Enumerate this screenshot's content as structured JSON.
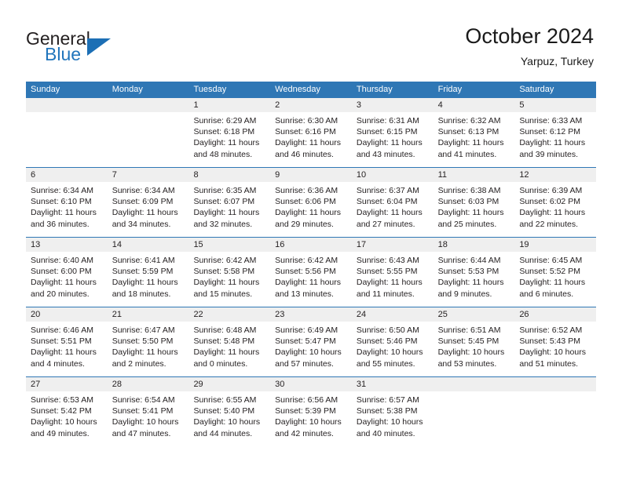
{
  "brand": {
    "word1": "General",
    "word2": "Blue",
    "triangle_color": "#1c6fb5",
    "blue_text_color": "#2175bc"
  },
  "header": {
    "title": "October 2024",
    "subtitle": "Yarpuz, Turkey"
  },
  "theme": {
    "header_blue": "#2f77b5",
    "datebar_gray": "#efefef",
    "cell_white": "#ffffff",
    "text": "#231f20"
  },
  "weekdays": [
    "Sunday",
    "Monday",
    "Tuesday",
    "Wednesday",
    "Thursday",
    "Friday",
    "Saturday"
  ],
  "weeks": [
    [
      {
        "day": "",
        "lines": []
      },
      {
        "day": "",
        "lines": []
      },
      {
        "day": "1",
        "lines": [
          "Sunrise: 6:29 AM",
          "Sunset: 6:18 PM",
          "Daylight: 11 hours",
          "and 48 minutes."
        ]
      },
      {
        "day": "2",
        "lines": [
          "Sunrise: 6:30 AM",
          "Sunset: 6:16 PM",
          "Daylight: 11 hours",
          "and 46 minutes."
        ]
      },
      {
        "day": "3",
        "lines": [
          "Sunrise: 6:31 AM",
          "Sunset: 6:15 PM",
          "Daylight: 11 hours",
          "and 43 minutes."
        ]
      },
      {
        "day": "4",
        "lines": [
          "Sunrise: 6:32 AM",
          "Sunset: 6:13 PM",
          "Daylight: 11 hours",
          "and 41 minutes."
        ]
      },
      {
        "day": "5",
        "lines": [
          "Sunrise: 6:33 AM",
          "Sunset: 6:12 PM",
          "Daylight: 11 hours",
          "and 39 minutes."
        ]
      }
    ],
    [
      {
        "day": "6",
        "lines": [
          "Sunrise: 6:34 AM",
          "Sunset: 6:10 PM",
          "Daylight: 11 hours",
          "and 36 minutes."
        ]
      },
      {
        "day": "7",
        "lines": [
          "Sunrise: 6:34 AM",
          "Sunset: 6:09 PM",
          "Daylight: 11 hours",
          "and 34 minutes."
        ]
      },
      {
        "day": "8",
        "lines": [
          "Sunrise: 6:35 AM",
          "Sunset: 6:07 PM",
          "Daylight: 11 hours",
          "and 32 minutes."
        ]
      },
      {
        "day": "9",
        "lines": [
          "Sunrise: 6:36 AM",
          "Sunset: 6:06 PM",
          "Daylight: 11 hours",
          "and 29 minutes."
        ]
      },
      {
        "day": "10",
        "lines": [
          "Sunrise: 6:37 AM",
          "Sunset: 6:04 PM",
          "Daylight: 11 hours",
          "and 27 minutes."
        ]
      },
      {
        "day": "11",
        "lines": [
          "Sunrise: 6:38 AM",
          "Sunset: 6:03 PM",
          "Daylight: 11 hours",
          "and 25 minutes."
        ]
      },
      {
        "day": "12",
        "lines": [
          "Sunrise: 6:39 AM",
          "Sunset: 6:02 PM",
          "Daylight: 11 hours",
          "and 22 minutes."
        ]
      }
    ],
    [
      {
        "day": "13",
        "lines": [
          "Sunrise: 6:40 AM",
          "Sunset: 6:00 PM",
          "Daylight: 11 hours",
          "and 20 minutes."
        ]
      },
      {
        "day": "14",
        "lines": [
          "Sunrise: 6:41 AM",
          "Sunset: 5:59 PM",
          "Daylight: 11 hours",
          "and 18 minutes."
        ]
      },
      {
        "day": "15",
        "lines": [
          "Sunrise: 6:42 AM",
          "Sunset: 5:58 PM",
          "Daylight: 11 hours",
          "and 15 minutes."
        ]
      },
      {
        "day": "16",
        "lines": [
          "Sunrise: 6:42 AM",
          "Sunset: 5:56 PM",
          "Daylight: 11 hours",
          "and 13 minutes."
        ]
      },
      {
        "day": "17",
        "lines": [
          "Sunrise: 6:43 AM",
          "Sunset: 5:55 PM",
          "Daylight: 11 hours",
          "and 11 minutes."
        ]
      },
      {
        "day": "18",
        "lines": [
          "Sunrise: 6:44 AM",
          "Sunset: 5:53 PM",
          "Daylight: 11 hours",
          "and 9 minutes."
        ]
      },
      {
        "day": "19",
        "lines": [
          "Sunrise: 6:45 AM",
          "Sunset: 5:52 PM",
          "Daylight: 11 hours",
          "and 6 minutes."
        ]
      }
    ],
    [
      {
        "day": "20",
        "lines": [
          "Sunrise: 6:46 AM",
          "Sunset: 5:51 PM",
          "Daylight: 11 hours",
          "and 4 minutes."
        ]
      },
      {
        "day": "21",
        "lines": [
          "Sunrise: 6:47 AM",
          "Sunset: 5:50 PM",
          "Daylight: 11 hours",
          "and 2 minutes."
        ]
      },
      {
        "day": "22",
        "lines": [
          "Sunrise: 6:48 AM",
          "Sunset: 5:48 PM",
          "Daylight: 11 hours",
          "and 0 minutes."
        ]
      },
      {
        "day": "23",
        "lines": [
          "Sunrise: 6:49 AM",
          "Sunset: 5:47 PM",
          "Daylight: 10 hours",
          "and 57 minutes."
        ]
      },
      {
        "day": "24",
        "lines": [
          "Sunrise: 6:50 AM",
          "Sunset: 5:46 PM",
          "Daylight: 10 hours",
          "and 55 minutes."
        ]
      },
      {
        "day": "25",
        "lines": [
          "Sunrise: 6:51 AM",
          "Sunset: 5:45 PM",
          "Daylight: 10 hours",
          "and 53 minutes."
        ]
      },
      {
        "day": "26",
        "lines": [
          "Sunrise: 6:52 AM",
          "Sunset: 5:43 PM",
          "Daylight: 10 hours",
          "and 51 minutes."
        ]
      }
    ],
    [
      {
        "day": "27",
        "lines": [
          "Sunrise: 6:53 AM",
          "Sunset: 5:42 PM",
          "Daylight: 10 hours",
          "and 49 minutes."
        ]
      },
      {
        "day": "28",
        "lines": [
          "Sunrise: 6:54 AM",
          "Sunset: 5:41 PM",
          "Daylight: 10 hours",
          "and 47 minutes."
        ]
      },
      {
        "day": "29",
        "lines": [
          "Sunrise: 6:55 AM",
          "Sunset: 5:40 PM",
          "Daylight: 10 hours",
          "and 44 minutes."
        ]
      },
      {
        "day": "30",
        "lines": [
          "Sunrise: 6:56 AM",
          "Sunset: 5:39 PM",
          "Daylight: 10 hours",
          "and 42 minutes."
        ]
      },
      {
        "day": "31",
        "lines": [
          "Sunrise: 6:57 AM",
          "Sunset: 5:38 PM",
          "Daylight: 10 hours",
          "and 40 minutes."
        ]
      },
      {
        "day": "",
        "lines": []
      },
      {
        "day": "",
        "lines": []
      }
    ]
  ]
}
